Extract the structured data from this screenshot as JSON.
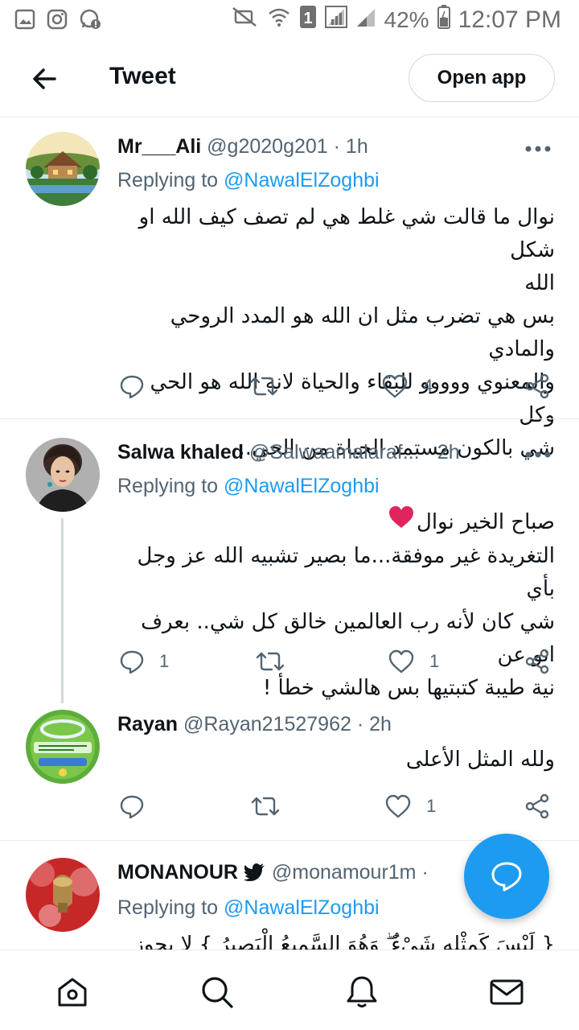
{
  "status_bar": {
    "battery": "42%",
    "time": "12:07 PM",
    "sim": "1",
    "icons": [
      "gallery-icon",
      "instagram-icon",
      "whatsapp-icon",
      "mute-icon",
      "wifi-icon",
      "signal-icon",
      "battery-icon"
    ]
  },
  "header": {
    "title": "Tweet",
    "open_app_label": "Open app"
  },
  "tweets": [
    {
      "name": "Mr___Ali",
      "handle": "@g2020g201",
      "time": "· 1h",
      "replying_prefix": "Replying to ",
      "replying_to": "@NawalElZoghbi",
      "lines": [
        "نوال ما قالت شي غلط هي لم تصف كيف الله او شكل",
        "الله",
        "بس هي تضرب مثل ان الله  هو المدد الروحي والمادي",
        "والمعنوي ووووو للبقاء والحياة  لانة الله هو الحي وكل",
        "شي بالكون مستمد الحياة من الحي.."
      ],
      "reply_count": "",
      "like_count": "4"
    },
    {
      "name": "Salwa khaled",
      "handle": "@Salwaamalaraf...",
      "time": "· 2h",
      "replying_prefix": "Replying to ",
      "replying_to": "@NawalElZoghbi",
      "lines": [
        "صباح الخير نوال",
        "التغريدة غير موفقة...ما بصير تشبيه الله عز وجل بأي",
        "شي كان لأنه رب العالمين خالق كل شي.. بعرف انو عن",
        "نية طيبة كتبتيها بس هالشي خطأ !"
      ],
      "reply_count": "1",
      "like_count": "1"
    },
    {
      "name": "Rayan",
      "handle": "@Rayan21527962",
      "time": "· 2h",
      "lines": [
        "ولله المثل الأعلى"
      ],
      "reply_count": "",
      "like_count": "1"
    },
    {
      "name": "MONANOUR",
      "handle": "@monamour1m",
      "time": "·",
      "replying_prefix": "Replying to ",
      "replying_to": "@NawalElZoghbi",
      "lines": [
        "{ لَيْسَ كَمِثْلِهِ شَيْءٌ ۖ وَهُوَ السَّمِيعُ الْبَصِيرُ } لا يجوز"
      ]
    }
  ],
  "colors": {
    "accent": "#1d9bf0",
    "text": "#0f1419",
    "secondary": "#536471",
    "heart": "#e0245e"
  }
}
